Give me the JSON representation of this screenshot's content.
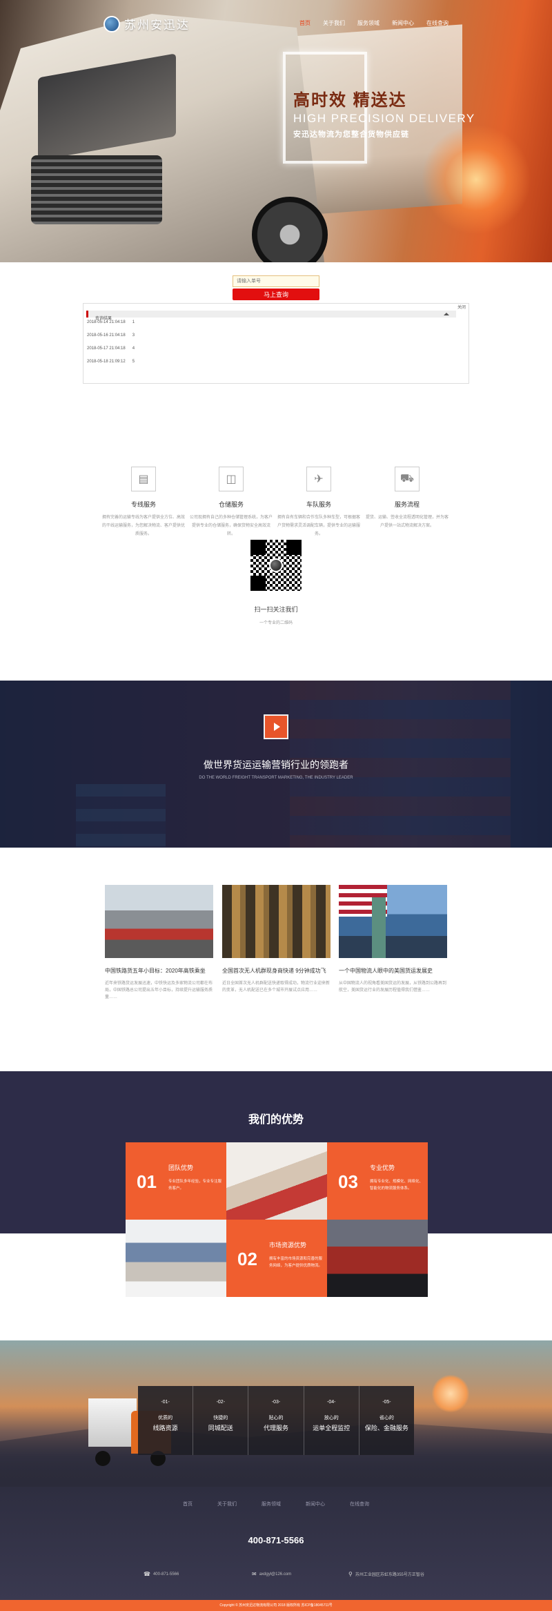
{
  "header": {
    "logo_text": "苏州安迅达",
    "nav": [
      "首页",
      "关于我们",
      "服务领域",
      "新闻中心",
      "在线查询"
    ]
  },
  "hero": {
    "title_cn": "高时效 精送达",
    "title_en": "HIGH PRECISION DELIVERY",
    "subtitle": "安迅达物流为您整合货物供应链"
  },
  "query": {
    "placeholder": "请输入单号",
    "button": "马上查询",
    "close": "关闭",
    "result_header": "查询结果",
    "results": [
      {
        "time": "2018-05-14 21:04:18",
        "no": "1"
      },
      {
        "time": "2018-05-16 21:04:18",
        "no": "3"
      },
      {
        "time": "2018-05-17 21:04:18",
        "no": "4"
      },
      {
        "time": "2018-05-18 21:09:12",
        "no": "5"
      }
    ]
  },
  "services": [
    {
      "title": "专线服务",
      "icon": "document-icon",
      "desc": "拥有完善的运输专线为客户提供全方位、高效的干线运输服务，为您解决物流、客户提供优质服务。"
    },
    {
      "title": "仓储服务",
      "icon": "warehouse-icon",
      "desc": "公司现拥有自己的多种仓储管理系统，为客户提供专业的仓储服务，确保货物安全高效流转。"
    },
    {
      "title": "车队服务",
      "icon": "airplane-icon",
      "desc": "拥有自有车辆和合作车队多种车型，可根据客户货物需求灵活调配车辆，提供专业的运输服务。"
    },
    {
      "title": "服务流程",
      "icon": "truck-icon",
      "desc": "提货、运输、签收全流程透明化管理，并为客户提供一站式物流解决方案。"
    }
  ],
  "qr": {
    "title": "扫一扫关注我们",
    "subtitle": "一个专业的二维码"
  },
  "banner": {
    "title": "做世界货运运输营销行业的领跑者",
    "subtitle": "DO THE WORLD FREIGHT TRANSPORT MARKETING, THE INDUSTRY LEADER"
  },
  "news": [
    {
      "title": "中国铁路货五年小目标：2020年高铁乘坐",
      "desc": "近年来铁路货运发展迅速，中铁快运及多家物流公司都在布局，中国铁路总公司提出五年小目标，持续提升运输服务质量……"
    },
    {
      "title": "全国首次无人机群现身商快递 9分钟成功飞",
      "desc": "近日全国首次无人机群配送快递取得成功，物流行业迎来新的变革，无人机配送已在多个城市开展试点应用……"
    },
    {
      "title": "一个中国物流人眼中的美国货运发展史",
      "desc": "从中国物流人的视角看美国货运的发展，从铁路到公路再到航空，美国货运行业的发展历程值得我们借鉴……"
    }
  ],
  "advantages": {
    "title": "我们的优势",
    "items": [
      {
        "num": "01",
        "title": "团队优势",
        "desc": "专业团队多年经验，专业专注服务客户。"
      },
      {
        "num": "03",
        "title": "专业优势",
        "desc": "拥有专业化、规模化、网络化、智能化的物流服务体系。"
      },
      {
        "num": "02",
        "title": "市场资源优势",
        "desc": "拥有丰富的市场资源和完善的服务网络，为客户提供优质物流。"
      }
    ]
  },
  "process": [
    {
      "num": "-01-",
      "line1": "优质的",
      "line2": "线路资源"
    },
    {
      "num": "-02-",
      "line1": "快捷的",
      "line2": "同城配送"
    },
    {
      "num": "-03-",
      "line1": "贴心的",
      "line2": "代理服务"
    },
    {
      "num": "-04-",
      "line1": "放心的",
      "line2": "运单全程监控"
    },
    {
      "num": "-05-",
      "line1": "省心的",
      "line2": "保险、金融服务"
    }
  ],
  "footer": {
    "nav": [
      "首页",
      "关于我们",
      "服务领域",
      "新闻中心",
      "在线查询"
    ],
    "phone": "400-871-5566",
    "contacts": {
      "phone": "400-871-5566",
      "email": "axdgyl@126.com",
      "address": "苏州工业园区苏虹东路355号方正智谷"
    },
    "copyright": "Copyright © 苏州安迅达物流有限公司 2018 版权所有 苏ICP备18045711号"
  }
}
